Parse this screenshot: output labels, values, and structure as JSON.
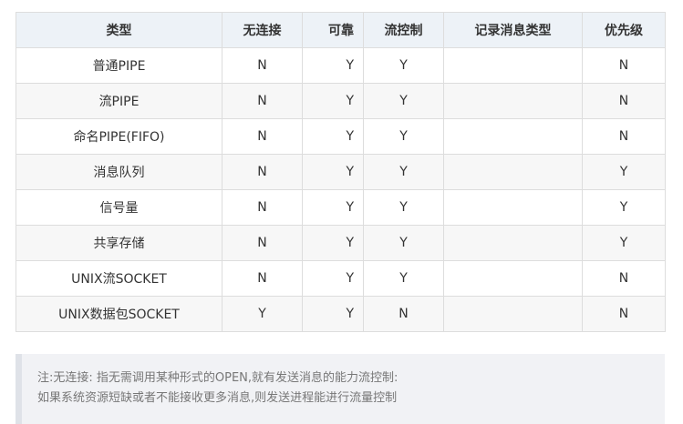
{
  "table": {
    "headers": [
      "类型",
      "无连接",
      "可靠",
      "流控制",
      "记录消息类型",
      "优先级"
    ],
    "rows": [
      [
        "普通PIPE",
        "N",
        "Y",
        "Y",
        "",
        "N"
      ],
      [
        "流PIPE",
        "N",
        "Y",
        "Y",
        "",
        "N"
      ],
      [
        "命名PIPE(FIFO)",
        "N",
        "Y",
        "Y",
        "",
        "N"
      ],
      [
        "消息队列",
        "N",
        "Y",
        "Y",
        "",
        "Y"
      ],
      [
        "信号量",
        "N",
        "Y",
        "Y",
        "",
        "Y"
      ],
      [
        "共享存储",
        "N",
        "Y",
        "Y",
        "",
        "Y"
      ],
      [
        "UNIX流SOCKET",
        "N",
        "Y",
        "Y",
        "",
        "N"
      ],
      [
        "UNIX数据包SOCKET",
        "Y",
        "Y",
        "N",
        "",
        "N"
      ]
    ]
  },
  "note": {
    "line1": "注:无连接: 指无需调用某种形式的OPEN,就有发送消息的能力流控制:",
    "line2": "如果系统资源短缺或者不能接收更多消息,则发送进程能进行流量控制"
  },
  "colors": {
    "header_bg": "#edf2f7",
    "stripe_bg": "#f7f7f7",
    "border": "#dddddd",
    "note_bg": "#f1f2f5",
    "note_bar": "#dfe2e8",
    "note_text": "#777777"
  }
}
